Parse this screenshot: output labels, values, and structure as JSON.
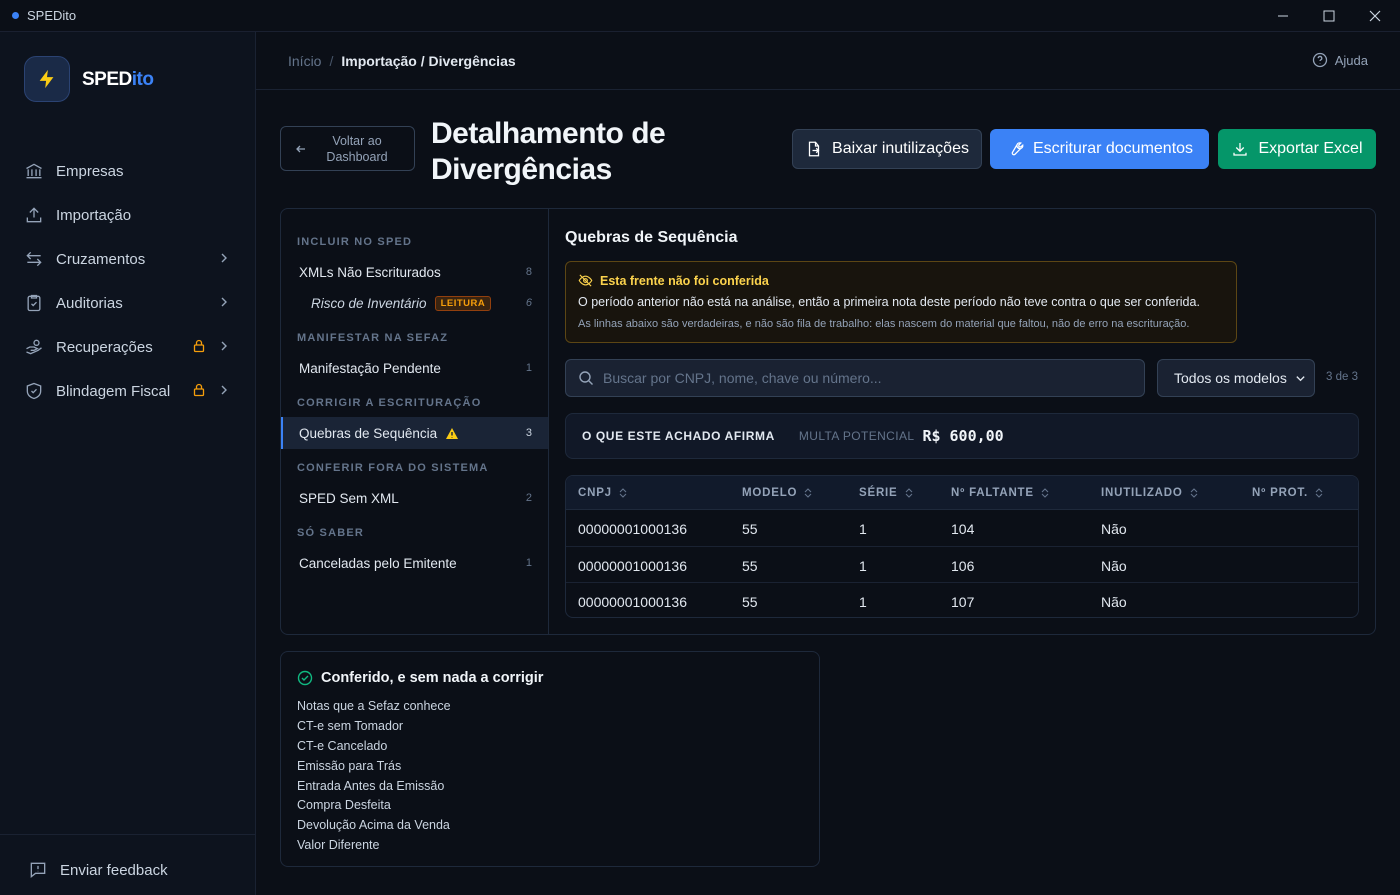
{
  "app": {
    "title": "SPEDito"
  },
  "logo": {
    "text_main": "SPED",
    "text_accent": "ito"
  },
  "sidebar": {
    "items": [
      {
        "label": "Empresas"
      },
      {
        "label": "Importação"
      },
      {
        "label": "Cruzamentos"
      },
      {
        "label": "Auditorias"
      },
      {
        "label": "Recuperações"
      },
      {
        "label": "Blindagem Fiscal"
      }
    ],
    "feedback": "Enviar feedback"
  },
  "breadcrumb": {
    "home": "Início",
    "sep": "/",
    "current": "Importação / Divergências"
  },
  "help": "Ajuda",
  "header": {
    "back": "Voltar ao Dashboard",
    "title": "Detalhamento de Divergências",
    "btn_download": "Baixar inutilizações",
    "btn_escriturar": "Escriturar documentos",
    "btn_export": "Exportar Excel"
  },
  "left": {
    "groups": [
      "INCLUIR NO SPED",
      "MANIFESTAR NA SEFAZ",
      "CORRIGIR A ESCRITURAÇÃO",
      "CONFERIR FORA DO SISTEMA",
      "SÓ SABER"
    ],
    "items": [
      {
        "label": "XMLs Não Escriturados",
        "count": "8"
      },
      {
        "label": "Risco de Inventário",
        "badge": "LEITURA",
        "count": "6"
      },
      {
        "label": "Manifestação Pendente",
        "count": "1"
      },
      {
        "label": "Quebras de Sequência",
        "count": "3"
      },
      {
        "label": "SPED Sem XML",
        "count": "2"
      },
      {
        "label": "Canceladas pelo Emitente",
        "count": "1"
      }
    ]
  },
  "detail": {
    "title": "Quebras de Sequência",
    "warning": {
      "heading": "Esta frente não foi conferida",
      "text": "O período anterior não está na análise, então a primeira nota deste período não teve contra o que ser conferida.",
      "note": "As linhas abaixo são verdadeiras, e não são fila de trabalho: elas nascem do material que faltou, não de erro na escrituração."
    },
    "search_placeholder": "Buscar por CNPJ, nome, chave ou número...",
    "filter_value": "Todos os modelos",
    "count": "3 de 3",
    "claim": {
      "label": "O QUE ESTE ACHADO AFIRMA",
      "metric": "MULTA POTENCIAL",
      "value": "R$ 600,00"
    },
    "table": {
      "headers": [
        "CNPJ",
        "MODELO",
        "SÉRIE",
        "Nº FALTANTE",
        "INUTILIZADO",
        "Nº PROT."
      ],
      "rows": [
        [
          "00000001000136",
          "55",
          "1",
          "104",
          "Não",
          ""
        ],
        [
          "00000001000136",
          "55",
          "1",
          "106",
          "Não",
          ""
        ],
        [
          "00000001000136",
          "55",
          "1",
          "107",
          "Não",
          ""
        ]
      ]
    }
  },
  "ok": {
    "heading": "Conferido, e sem nada a corrigir",
    "items": [
      "Notas que a Sefaz conhece",
      "CT-e sem Tomador",
      "CT-e Cancelado",
      "Emissão para Trás",
      "Entrada Antes da Emissão",
      "Compra Desfeita",
      "Devolução Acima da Venda",
      "Valor Diferente"
    ]
  },
  "colors": {
    "accent": "#3b82f6",
    "success": "#059669",
    "warning": "#f59e0b",
    "bg": "#0b0f17"
  }
}
